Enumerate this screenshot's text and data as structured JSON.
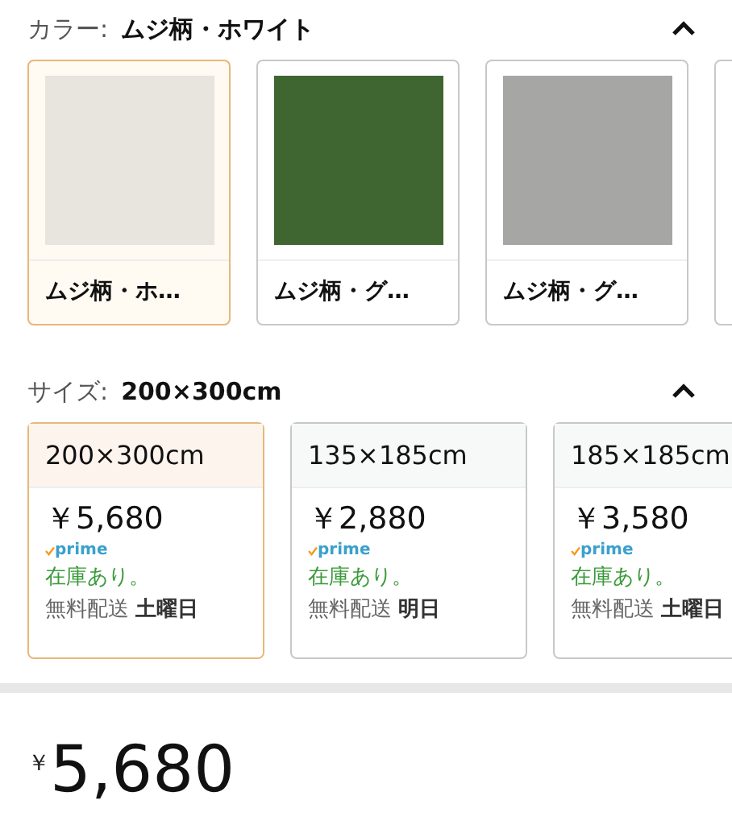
{
  "color_section": {
    "label": "カラー:",
    "value": "ムジ柄・ホワイト",
    "expanded": true,
    "options": [
      {
        "name": "ムジ柄・ホ…",
        "color": "#e8e4de",
        "selected": true
      },
      {
        "name": "ムジ柄・グ…",
        "color": "#3f6630",
        "selected": false
      },
      {
        "name": "ムジ柄・グ…",
        "color": "#a6a6a4",
        "selected": false
      }
    ]
  },
  "size_section": {
    "label": "サイズ:",
    "value": "200×300cm",
    "expanded": true,
    "options": [
      {
        "size": "200×300cm",
        "price": "￥5,680",
        "prime": "prime",
        "stock": "在庫あり。",
        "shipping": "無料配送",
        "day": "土曜日",
        "selected": true
      },
      {
        "size": "135×185cm",
        "price": "￥2,880",
        "prime": "prime",
        "stock": "在庫あり。",
        "shipping": "無料配送",
        "day": "明日",
        "selected": false
      },
      {
        "size": "185×185cm",
        "price": "￥3,580",
        "prime": "prime",
        "stock": "在庫あり。",
        "shipping": "無料配送",
        "day": "土曜日",
        "selected": false
      }
    ]
  },
  "price": {
    "currency": "￥",
    "amount": "5,680"
  }
}
